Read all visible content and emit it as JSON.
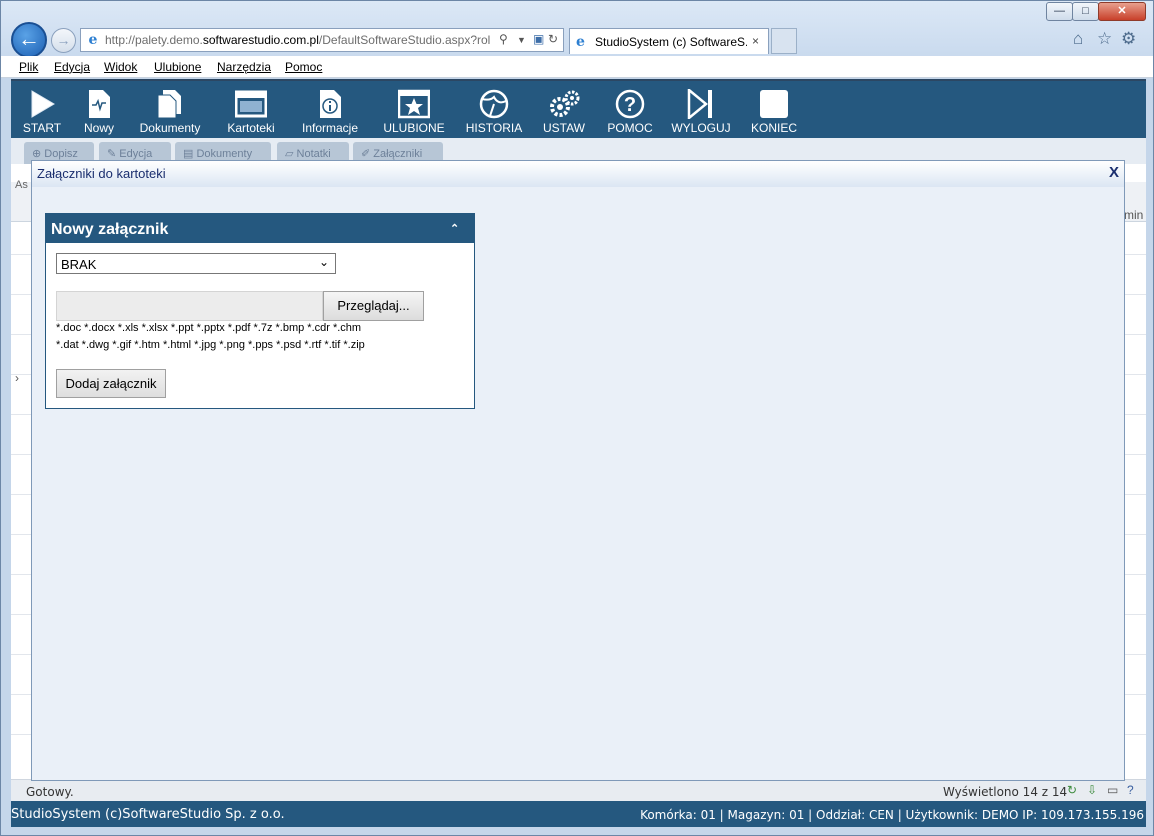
{
  "browser": {
    "url_prefix": "http://palety.demo.",
    "url_domain": "softwarestudio.com.pl",
    "url_suffix": "/DefaultSoftwareStudio.aspx?rol",
    "tab_title": "StudioSystem (c) SoftwareS...",
    "tab_close": "×",
    "menu": [
      "Plik",
      "Edycja",
      "Widok",
      "Ulubione",
      "Narzędzia",
      "Pomoc"
    ]
  },
  "toolbar": {
    "items": [
      {
        "label": "START",
        "icon": "play-icon"
      },
      {
        "label": "Nowy",
        "icon": "new-document-icon"
      },
      {
        "label": "Dokumenty",
        "icon": "documents-icon"
      },
      {
        "label": "Kartoteki",
        "icon": "window-icon"
      },
      {
        "label": "Informacje",
        "icon": "info-icon"
      },
      {
        "label": "ULUBIONE",
        "icon": "star-icon"
      },
      {
        "label": "HISTORIA",
        "icon": "history-icon"
      },
      {
        "label": "USTAW",
        "icon": "gears-icon"
      },
      {
        "label": "POMOC",
        "icon": "help-icon"
      },
      {
        "label": "WYLOGUJ",
        "icon": "logout-icon"
      },
      {
        "label": "KONIEC",
        "icon": "stop-icon"
      }
    ]
  },
  "subtabs": [
    "Dopisz",
    "Edycja",
    "Dokumenty",
    "Notatki",
    "Załączniki"
  ],
  "background": {
    "col_fragment_left": "As",
    "col_fragment_right": "min",
    "expand_arrow": "›"
  },
  "status": {
    "text": "Gotowy.",
    "shown": "Wyświetlono 14 z 14"
  },
  "footer": {
    "left": "StudioSystem (c)SoftwareStudio Sp. z o.o.",
    "right": "Komórka: 01 | Magazyn: 01 | Oddział: CEN | Użytkownik: DEMO IP: 109.173.155.196"
  },
  "modal": {
    "title": "Załączniki do kartoteki",
    "close": "X",
    "panel": {
      "title": "Nowy załącznik",
      "collapse": "⌃",
      "select_value": "BRAK",
      "browse_label": "Przeglądaj...",
      "extensions_line1": "*.doc *.docx *.xls *.xlsx *.ppt *.pptx *.pdf *.7z *.bmp *.cdr *.chm",
      "extensions_line2": "*.dat *.dwg *.gif *.htm *.html *.jpg *.png *.pps *.psd *.rtf *.tif *.zip",
      "add_label": "Dodaj załącznik"
    }
  }
}
